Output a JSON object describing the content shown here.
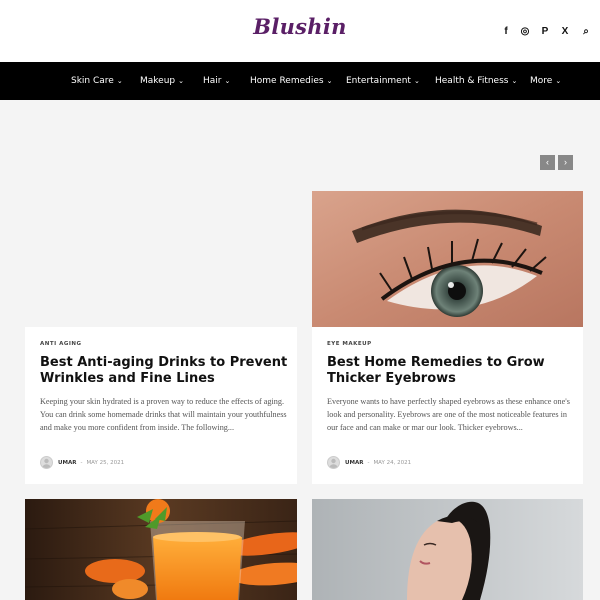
{
  "header": {
    "logo": "Blushin",
    "social": [
      {
        "icon": "facebook-icon",
        "glyph": "f"
      },
      {
        "icon": "instagram-icon",
        "glyph": "◎"
      },
      {
        "icon": "pinterest-icon",
        "glyph": "P"
      },
      {
        "icon": "x-twitter-icon",
        "glyph": "X"
      },
      {
        "icon": "search-icon",
        "glyph": "⌕"
      }
    ]
  },
  "nav": {
    "items": [
      {
        "label": "Skin Care"
      },
      {
        "label": "Makeup"
      },
      {
        "label": "Hair"
      },
      {
        "label": "Home Remedies"
      },
      {
        "label": "Entertainment"
      },
      {
        "label": "Health & Fitness"
      },
      {
        "label": "More"
      }
    ]
  },
  "slider": {
    "prev": "‹",
    "next": "›"
  },
  "cards": [
    {
      "category": "ANTI AGING",
      "title": "Best Anti-aging Drinks to Prevent Wrinkles and Fine Lines",
      "excerpt": "Keeping your skin hydrated is a proven way to reduce the effects of aging.  You can drink some homemade drinks that will maintain your youthfulness and make you more confident from inside. The following...",
      "author": "UMAR",
      "date": "MAY 25, 2021",
      "separator": "-"
    },
    {
      "category": "EYE MAKEUP",
      "title": "Best Home Remedies to Grow Thicker Eyebrows",
      "excerpt": "Everyone wants to have perfectly shaped eyebrows as these enhance one's look and personality. Eyebrows are one of the most noticeable features in our face and can make or mar our look. Thicker eyebrows...",
      "author": "UMAR",
      "date": "MAY 24, 2021",
      "separator": "-"
    }
  ],
  "colors": {
    "brand": "#5a1f66",
    "nav_bg": "#000000",
    "page_bg": "#f4f4f4"
  }
}
